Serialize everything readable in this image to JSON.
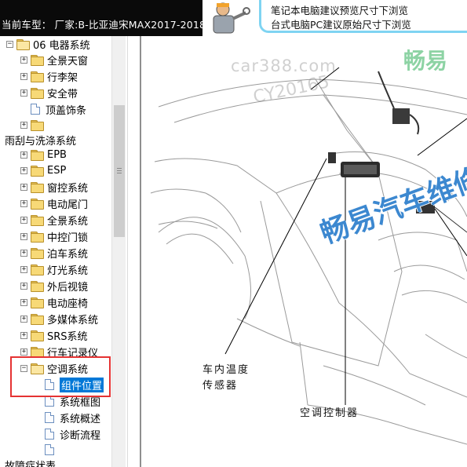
{
  "header": {
    "current_car_label": "当前车型：  厂家:B-比亚迪宋MAX2017-2018",
    "notice_line1": "笔记本电脑建议预览尺寸下浏览",
    "notice_line2": "台式电脑PC建议原始尺寸下浏览"
  },
  "tree": {
    "rows": [
      {
        "label": "06 电器系统",
        "expander": "⊟",
        "icon": "folder-open"
      },
      {
        "label": "全景天窗",
        "expander": "⊞",
        "icon": "folder"
      },
      {
        "label": "行李架",
        "expander": "⊞",
        "icon": "folder"
      },
      {
        "label": "安全带",
        "expander": "⊞",
        "icon": "folder"
      },
      {
        "label": "顶盖饰条",
        "expander": "",
        "icon": "page"
      },
      {
        "label": "",
        "expander": "⊞",
        "icon": "folder"
      },
      {
        "label": "雨刮与洗涤系统",
        "expander": "",
        "icon": "none"
      },
      {
        "label": "EPB",
        "expander": "⊞",
        "icon": "folder"
      },
      {
        "label": "ESP",
        "expander": "⊞",
        "icon": "folder"
      },
      {
        "label": "窗控系统",
        "expander": "⊞",
        "icon": "folder"
      },
      {
        "label": "电动尾门",
        "expander": "⊞",
        "icon": "folder"
      },
      {
        "label": "全景系统",
        "expander": "⊞",
        "icon": "folder"
      },
      {
        "label": "中控门锁",
        "expander": "⊞",
        "icon": "folder"
      },
      {
        "label": "泊车系统",
        "expander": "⊞",
        "icon": "folder"
      },
      {
        "label": "灯光系统",
        "expander": "⊞",
        "icon": "folder"
      },
      {
        "label": "外后视镜",
        "expander": "⊞",
        "icon": "folder"
      },
      {
        "label": "电动座椅",
        "expander": "⊞",
        "icon": "folder"
      },
      {
        "label": "多媒体系统",
        "expander": "⊞",
        "icon": "folder"
      },
      {
        "label": "SRS系统",
        "expander": "⊞",
        "icon": "folder"
      },
      {
        "label": "行车记录仪",
        "expander": "⊞",
        "icon": "folder"
      },
      {
        "label": "空调系统",
        "expander": "⊟",
        "icon": "folder-open"
      },
      {
        "label": "组件位置",
        "expander": "",
        "icon": "page",
        "selected": true
      },
      {
        "label": "系统框图",
        "expander": "",
        "icon": "page"
      },
      {
        "label": "系统概述",
        "expander": "",
        "icon": "page"
      },
      {
        "label": "诊断流程",
        "expander": "",
        "icon": "page"
      },
      {
        "label": "",
        "expander": "",
        "icon": "page"
      },
      {
        "label": "故障症状表",
        "expander": "",
        "icon": "none"
      }
    ]
  },
  "diagram": {
    "callout_cabin_temp_line1": "车内温度",
    "callout_cabin_temp_line2": "传感器",
    "callout_ac_controller": "空调控制器"
  },
  "watermarks": {
    "site": "car388.com",
    "code": "CY20165",
    "brand_small": "畅易",
    "brand_large": "畅易汽车维修"
  },
  "colors": {
    "header_bg": "#0a0a0a",
    "notice_border": "#7fd4f2",
    "highlight_border": "#e53333",
    "selection_bg": "#0078d7",
    "watermark_blue": "#1a73c8",
    "watermark_green": "#2fae5a"
  }
}
